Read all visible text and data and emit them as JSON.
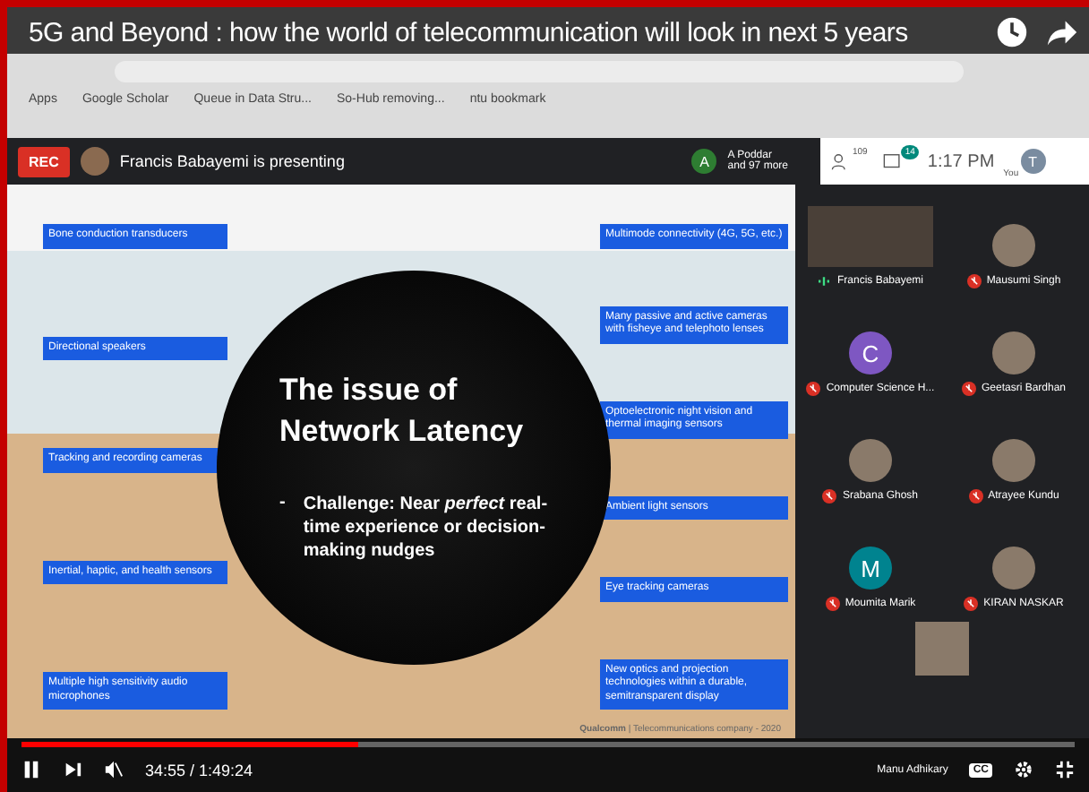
{
  "video_title": "5G and Beyond : how the world of telecommunication will look in next 5 years",
  "bookmarks": [
    "Apps",
    "Google Scholar",
    "Queue in Data Stru...",
    "So-Hub removing...",
    "ntu bookmark"
  ],
  "meet_bar": {
    "rec": "REC",
    "presenting": "Francis Babayemi is presenting",
    "others_avatar": "A",
    "others_line1": "A Poddar",
    "others_line2": "and 97 more",
    "people_count": "109",
    "chat_count": "14",
    "time": "1:17 PM",
    "self_label": "You",
    "self_avatar": "T"
  },
  "slide": {
    "title_line1": "The issue of",
    "title_line2": "Network Latency",
    "bullet": "-",
    "challenge": "Challenge: Near *perfect* real-time experience or decision-making nudges",
    "left_labels": [
      "Bone conduction transducers",
      "Directional speakers",
      "Tracking and recording cameras",
      "Inertial, haptic, and health sensors",
      "Multiple high sensitivity audio microphones"
    ],
    "right_labels": [
      "Multimode connectivity (4G, 5G, etc.)",
      "Many passive and active cameras with fisheye and telephoto lenses",
      "Optoelectronic night vision and thermal imaging sensors",
      "Ambient light sensors",
      "Eye tracking cameras",
      "New optics and projection technologies within a durable, semitransparent display"
    ],
    "footer": "**Qualcomm** | Telecommunications company - 2020"
  },
  "participants": [
    {
      "name": "Francis Babayemi",
      "kind": "video",
      "muted": false
    },
    {
      "name": "Mausumi Singh",
      "kind": "photo",
      "muted": true
    },
    {
      "name": "Computer Science H...",
      "kind": "letter",
      "letter": "C",
      "color": "#7e57c2",
      "muted": true
    },
    {
      "name": "Geetasri Bardhan",
      "kind": "photo",
      "muted": true
    },
    {
      "name": "Srabana Ghosh",
      "kind": "photo",
      "muted": true
    },
    {
      "name": "Atrayee Kundu",
      "kind": "photo",
      "muted": true
    },
    {
      "name": "Moumita Marik",
      "kind": "letter",
      "letter": "M",
      "color": "#00838f",
      "muted": true
    },
    {
      "name": "KIRAN NASKAR",
      "kind": "photo",
      "muted": true
    }
  ],
  "bottom_participant": "Manu Adhikary",
  "player": {
    "level": 0.32,
    "time": "34:55 / 1:49:24",
    "cc": "CC"
  }
}
